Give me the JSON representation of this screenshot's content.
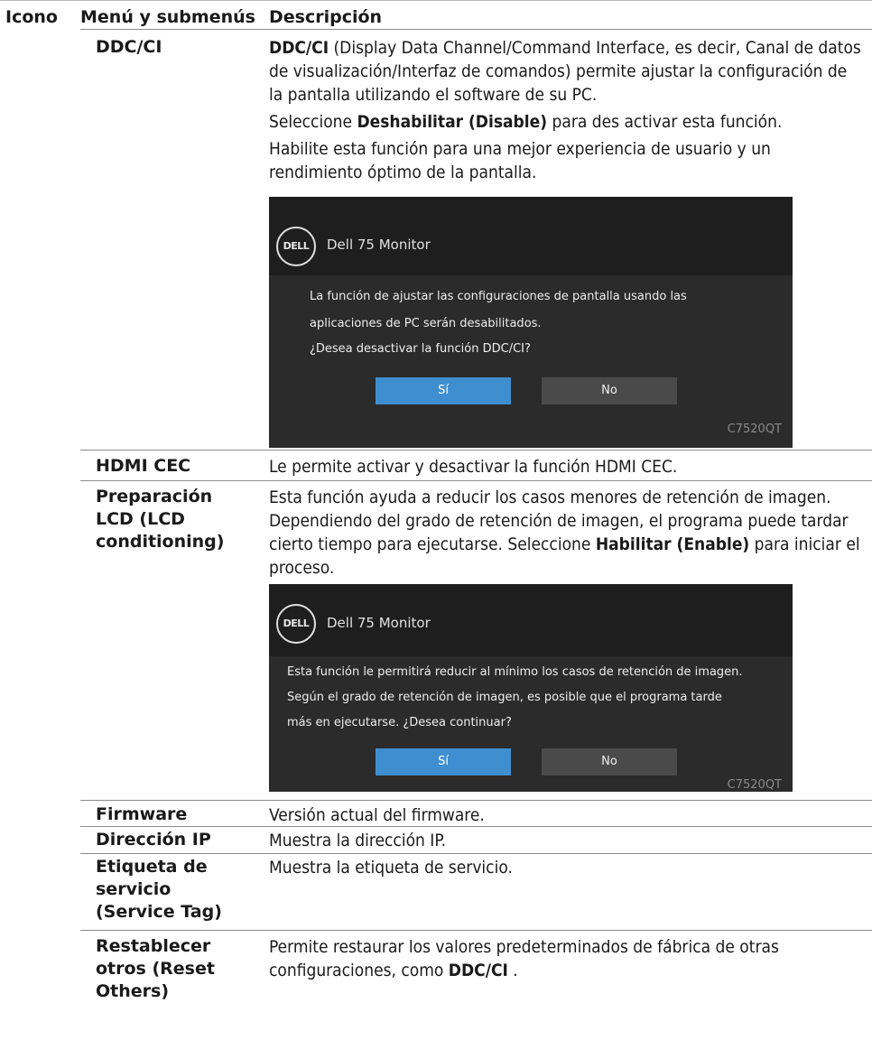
{
  "header": {
    "col_icon": "Icono",
    "col_menu": "Menú y submenús",
    "col_desc": "Descripción"
  },
  "rows": {
    "ddcci": {
      "menu": "DDC/CI",
      "desc_p1_bold": "DDC/CI",
      "desc_p1_rest": " (Display Data Channel/Command Interface, es decir, Canal de datos de visualización/Interfaz de comandos) permite ajustar la configuración de la pantalla utilizando el software de su PC.",
      "desc_p2_pre": "Seleccione ",
      "desc_p2_bold": "Deshabilitar (Disable)",
      "desc_p2_post": " para des activar esta función.",
      "desc_p3": "Habilite esta función para una mejor experiencia de usuario y un rendimiento óptimo de la pantalla."
    },
    "hdmi_cec": {
      "menu": "HDMI CEC",
      "desc": "Le permite activar y desactivar la función HDMI CEC."
    },
    "lcd": {
      "menu": "Preparación LCD (LCD conditioning)",
      "desc_pre": "Esta función ayuda a reducir los casos menores de retención de imagen. Dependiendo del grado de retención de imagen, el programa puede tardar cierto tiempo para ejecutarse. Seleccione ",
      "desc_bold": "Habilitar (Enable)",
      "desc_post": " para iniciar el proceso."
    },
    "firmware": {
      "menu": "Firmware",
      "desc": "Versión actual del firmware."
    },
    "ip": {
      "menu": "Dirección IP",
      "desc": "Muestra la dirección IP."
    },
    "service_tag": {
      "menu": "Etiqueta de servicio (Service Tag)",
      "desc": "Muestra la etiqueta de servicio."
    },
    "reset": {
      "menu": "Restablecer otros (Reset Others)",
      "desc_pre": "Permite restaurar los valores predeterminados de fábrica de otras configuraciones, como ",
      "desc_bold": "DDC/CI",
      "desc_post": " ."
    }
  },
  "osd1": {
    "logo": "DELL",
    "title": "Dell 75 Monitor",
    "line1": "La función de ajustar las configuraciones de pantalla usando las",
    "line2": "aplicaciones de PC serán desabilitados.",
    "line3": "¿Desea desactivar la función DDC/CI?",
    "yes": "Sí",
    "no": "No",
    "model": "C7520QT"
  },
  "osd2": {
    "logo": "DELL",
    "title": "Dell 75 Monitor",
    "line1": "Esta función le permitirá reducir al mínimo los casos de retención de imagen.",
    "line2": "Según el grado de retención de imagen, es posible que el programa tarde",
    "line3": "más en ejecutarse. ¿Desea continuar?",
    "yes": "Sí",
    "no": "No",
    "model": "C7520QT"
  }
}
